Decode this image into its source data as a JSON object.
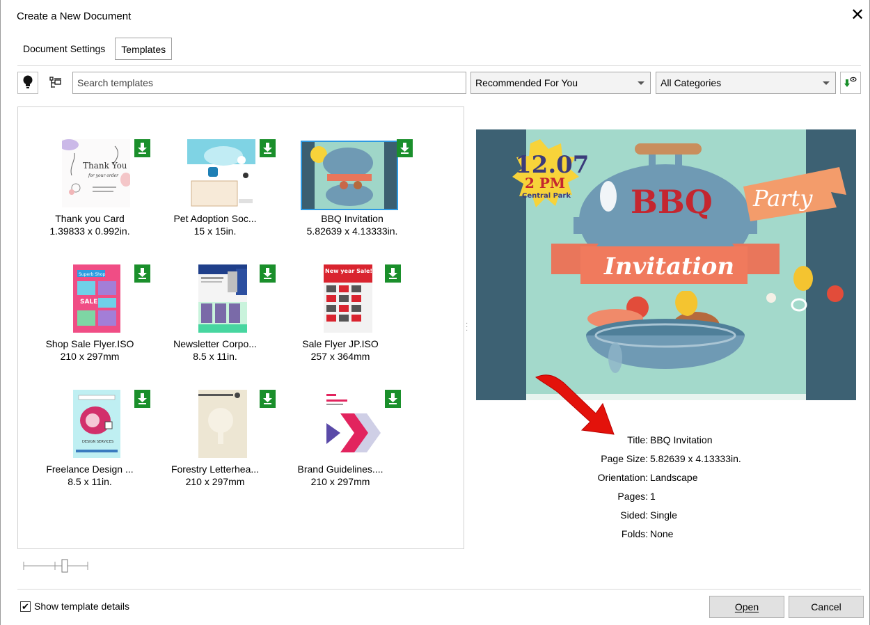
{
  "window": {
    "title": "Create a New Document",
    "close_glyph": "✕"
  },
  "tabs": [
    {
      "label": "Document Settings",
      "active": false
    },
    {
      "label": "Templates",
      "active": true
    }
  ],
  "toolbar": {
    "search_placeholder": "Search templates",
    "sort_value": "Recommended For You",
    "category_value": "All Categories"
  },
  "templates": [
    {
      "name": "Thank you Card",
      "size": "1.39833 x 0.992in.",
      "selected": false
    },
    {
      "name": "Pet Adoption Soc...",
      "size": "15 x 15in.",
      "selected": false
    },
    {
      "name": "BBQ Invitation",
      "size": "5.82639 x 4.13333in.",
      "selected": true
    },
    {
      "name": "Shop Sale Flyer.ISO",
      "size": "210 x 297mm",
      "selected": false
    },
    {
      "name": "Newsletter Corpo...",
      "size": "8.5 x 11in.",
      "selected": false
    },
    {
      "name": "Sale Flyer JP.ISO",
      "size": "257 x 364mm",
      "selected": false
    },
    {
      "name": "Freelance Design ...",
      "size": "8.5 x 11in.",
      "selected": false
    },
    {
      "name": "Forestry Letterhea...",
      "size": "210 x 297mm",
      "selected": false
    },
    {
      "name": "Brand Guidelines....",
      "size": "210 x 297mm",
      "selected": false
    }
  ],
  "thumb_text": {
    "thank_you": "Thank You",
    "for_your_order": "for your order",
    "sale_badge_title": "Superb Shop",
    "sale_word": "SALE",
    "new_year": "New year Sale!",
    "design_services": "DESIGN SERVICES"
  },
  "preview": {
    "date": "12.07",
    "time": "2 PM",
    "place": "Central Park",
    "headline": "BBQ",
    "ribbon_word": "Invitation",
    "flag_word": "Party"
  },
  "details": [
    {
      "label": "Title:",
      "value": "BBQ Invitation"
    },
    {
      "label": "Page Size:",
      "value": "5.82639 x 4.13333in."
    },
    {
      "label": "Orientation:",
      "value": "Landscape"
    },
    {
      "label": "Pages:",
      "value": "1"
    },
    {
      "label": "Sided:",
      "value": "Single"
    },
    {
      "label": "Folds:",
      "value": "None"
    }
  ],
  "footer": {
    "show_details_label": "Show template details",
    "show_details_checked": true,
    "open_label": "Open",
    "cancel_label": "Cancel"
  },
  "colors": {
    "download_badge": "#1a8f2b",
    "selection": "#2e9ae2",
    "annotation_arrow": "#e3120b"
  }
}
